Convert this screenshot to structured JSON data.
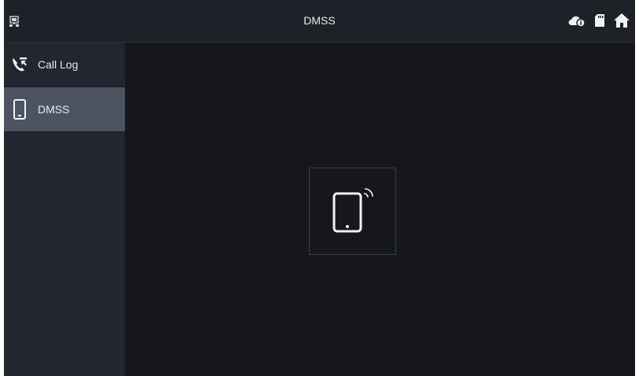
{
  "header": {
    "title": "DMSS",
    "left_icon": "network-icon",
    "status_icons": [
      "cloud-info-icon",
      "sd-card-icon",
      "home-icon"
    ]
  },
  "sidebar": {
    "items": [
      {
        "label": "Call Log",
        "icon": "call-log-icon",
        "active": false
      },
      {
        "label": "DMSS",
        "icon": "phone-icon",
        "active": true
      }
    ]
  },
  "main": {
    "tile_icon": "tablet-wireless-icon"
  },
  "colors": {
    "background": "#15171c",
    "topbar": "#1e2128",
    "sidebar": "#23262e",
    "sidebar_active": "#4c5462",
    "text": "#e9eaec"
  }
}
